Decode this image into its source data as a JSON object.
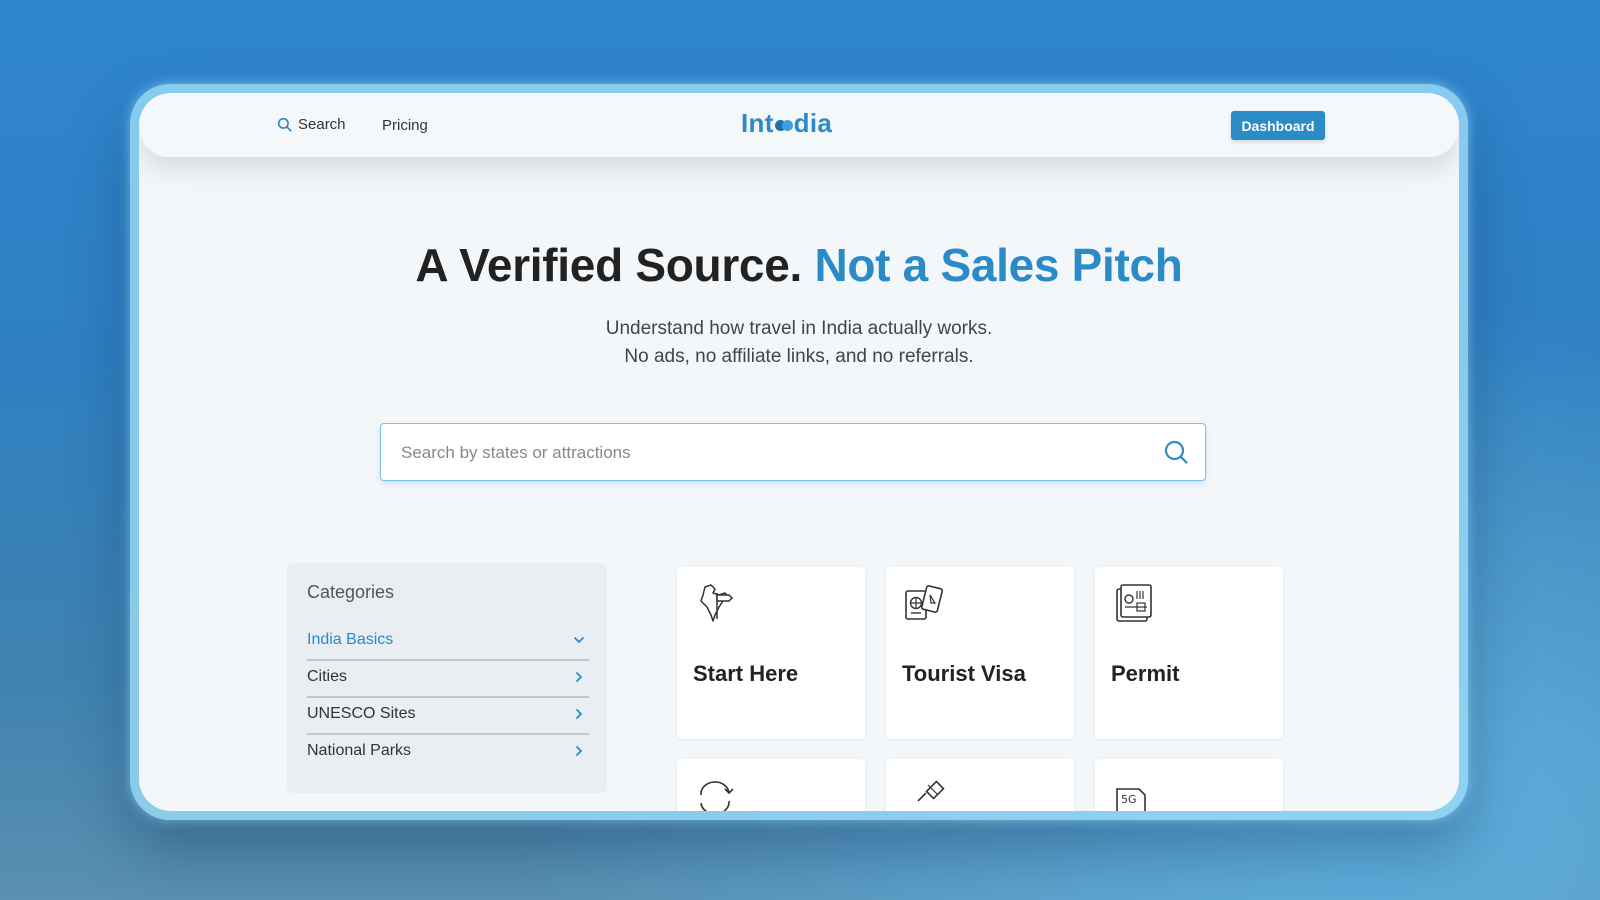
{
  "nav": {
    "search_label": "Search",
    "pricing_label": "Pricing",
    "logo_left": "Int",
    "logo_right": "dia",
    "dashboard_label": "Dashboard"
  },
  "hero": {
    "title_main": "A Verified Source.",
    "title_accent": "Not a Sales Pitch",
    "subtitle_line1": "Understand how travel in India actually works.",
    "subtitle_line2": "No ads, no affiliate links, and no referrals."
  },
  "search": {
    "placeholder": "Search by states or attractions",
    "value": ""
  },
  "categories": {
    "title": "Categories",
    "items": [
      {
        "label": "India Basics",
        "active": true,
        "chevron": "chevron-down-icon"
      },
      {
        "label": "Cities",
        "active": false,
        "chevron": "chevron-right-icon"
      },
      {
        "label": "UNESCO Sites",
        "active": false,
        "chevron": "chevron-right-icon"
      },
      {
        "label": "National Parks",
        "active": false,
        "chevron": "chevron-right-icon"
      }
    ]
  },
  "cards": [
    {
      "label": "Start Here",
      "icon": "india-map-signpost-icon"
    },
    {
      "label": "Tourist Visa",
      "icon": "passport-icon"
    },
    {
      "label": "Permit",
      "icon": "permit-document-icon"
    },
    {
      "label": "",
      "icon": "currency-exchange-icon"
    },
    {
      "label": "",
      "icon": "satellite-icon"
    },
    {
      "label": "",
      "icon": "sim-card-5g-icon"
    }
  ],
  "colors": {
    "accent": "#2a8bc7",
    "text_dark": "#222222",
    "page_bg": "#f3f7fa",
    "sidebar_bg": "#e9eef2"
  }
}
